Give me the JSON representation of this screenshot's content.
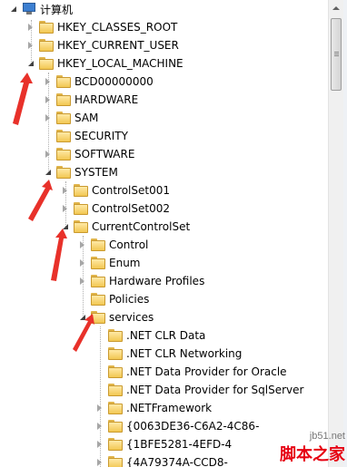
{
  "root": {
    "label": "计算机",
    "icon": "computer-icon"
  },
  "nodes": [
    {
      "id": "hkcr",
      "label": "HKEY_CLASSES_ROOT",
      "state": "collapsed"
    },
    {
      "id": "hkcu",
      "label": "HKEY_CURRENT_USER",
      "state": "collapsed"
    },
    {
      "id": "hklm",
      "label": "HKEY_LOCAL_MACHINE",
      "state": "expanded"
    },
    {
      "id": "bcd",
      "label": "BCD00000000",
      "state": "collapsed"
    },
    {
      "id": "hardware",
      "label": "HARDWARE",
      "state": "collapsed"
    },
    {
      "id": "sam",
      "label": "SAM",
      "state": "collapsed"
    },
    {
      "id": "security",
      "label": "SECURITY",
      "state": "none"
    },
    {
      "id": "software",
      "label": "SOFTWARE",
      "state": "collapsed"
    },
    {
      "id": "system",
      "label": "SYSTEM",
      "state": "expanded"
    },
    {
      "id": "cs001",
      "label": "ControlSet001",
      "state": "collapsed"
    },
    {
      "id": "cs002",
      "label": "ControlSet002",
      "state": "collapsed"
    },
    {
      "id": "ccs",
      "label": "CurrentControlSet",
      "state": "expanded"
    },
    {
      "id": "control",
      "label": "Control",
      "state": "collapsed"
    },
    {
      "id": "enum",
      "label": "Enum",
      "state": "collapsed"
    },
    {
      "id": "hwprof",
      "label": "Hardware Profiles",
      "state": "collapsed"
    },
    {
      "id": "policies",
      "label": "Policies",
      "state": "none"
    },
    {
      "id": "services",
      "label": "services",
      "state": "expanded"
    },
    {
      "id": "clrdata",
      "label": ".NET CLR Data",
      "state": "none"
    },
    {
      "id": "clrnet",
      "label": ".NET CLR Networking",
      "state": "none"
    },
    {
      "id": "dpo",
      "label": ".NET Data Provider for Oracle",
      "state": "none"
    },
    {
      "id": "dps",
      "label": ".NET Data Provider for SqlServer",
      "state": "none"
    },
    {
      "id": "netfx",
      "label": ".NETFramework",
      "state": "collapsed"
    },
    {
      "id": "g1",
      "label": "{0063DE36-C6A2-4C86-",
      "state": "collapsed"
    },
    {
      "id": "g2",
      "label": "{1BFE5281-4EFD-4",
      "state": "collapsed"
    },
    {
      "id": "g3",
      "label": "{4A79374A-CCD8-",
      "state": "collapsed"
    }
  ],
  "watermark": {
    "url": "jb51.net",
    "text": "脚本之家"
  },
  "colors": {
    "arrow": "#e8312a",
    "folder": "#f2c752"
  }
}
